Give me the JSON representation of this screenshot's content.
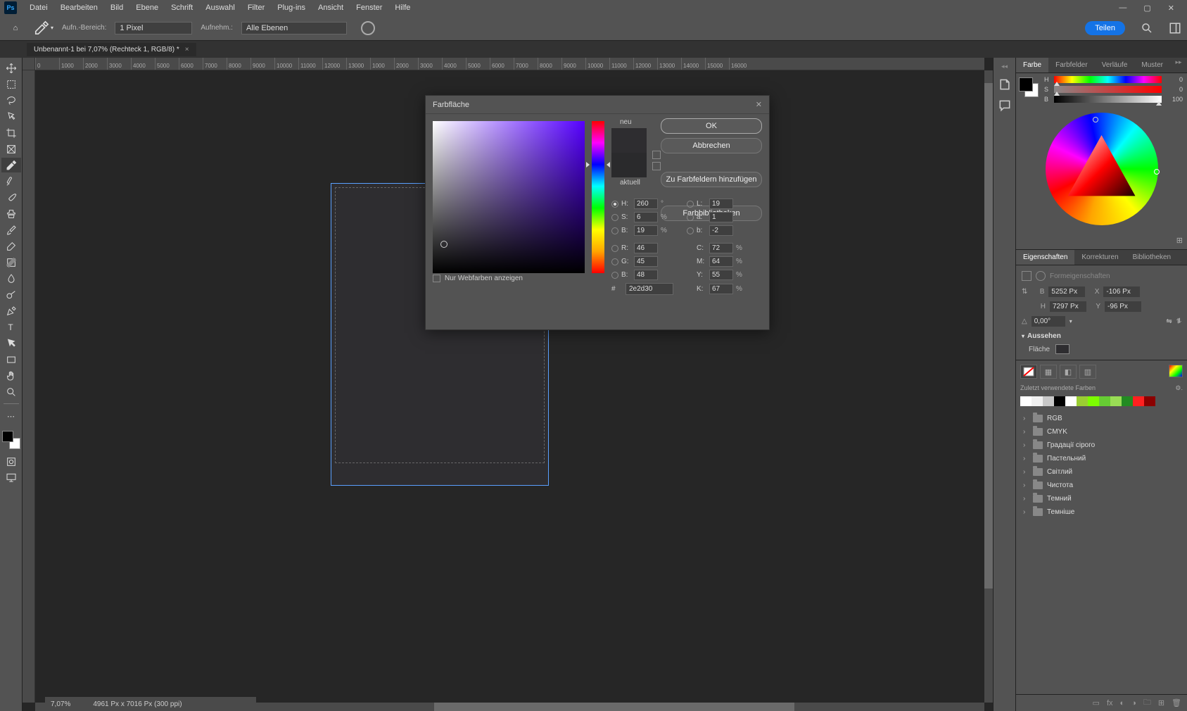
{
  "menubar": {
    "items": [
      "Datei",
      "Bearbeiten",
      "Bild",
      "Ebene",
      "Schrift",
      "Auswahl",
      "Filter",
      "Plug-ins",
      "Ansicht",
      "Fenster",
      "Hilfe"
    ]
  },
  "optionsbar": {
    "sample_label": "Aufn.-Bereich:",
    "sample_value": "1 Pixel",
    "sample2_label": "Aufnehm.:",
    "sample2_value": "Alle Ebenen",
    "share": "Teilen"
  },
  "doctab": {
    "title": "Unbenannt-1 bei 7,07% (Rechteck 1, RGB/8) *"
  },
  "ruler_marks": [
    "0",
    "1000",
    "2000",
    "3000",
    "4000",
    "5000",
    "6000",
    "7000",
    "8000",
    "9000",
    "10000",
    "11000",
    "12000",
    "13000",
    "1000",
    "2000",
    "3000",
    "4000",
    "5000",
    "6000",
    "7000",
    "8000",
    "9000",
    "10000",
    "11000",
    "12000",
    "13000",
    "14000",
    "15000",
    "16000"
  ],
  "footer": {
    "zoom": "7,07%",
    "docinfo": "4961 Px x 7016 Px (300 ppi)"
  },
  "color_panel": {
    "tabs": [
      "Farbe",
      "Farbfelder",
      "Verläufe",
      "Muster"
    ],
    "h": "0",
    "s": "0",
    "b": "100"
  },
  "props_panel": {
    "tabs": [
      "Eigenschaften",
      "Korrekturen",
      "Bibliotheken"
    ],
    "shape_label": "Formeigenschaften",
    "B": "5252 Px",
    "H": "7297 Px",
    "X": "-106 Px",
    "Y": "-96 Px",
    "angle": "0,00°",
    "section": "Aussehen",
    "fill_label": "Fläche"
  },
  "swatches_panel": {
    "recent_label": "Zuletzt verwendete Farben",
    "recent": [
      "#ffffff",
      "#f0f0f0",
      "#c8c8c8",
      "#000000",
      "#ffffff",
      "#9acd32",
      "#7cfc00",
      "#66cc33",
      "#99dd55",
      "#228b22",
      "#ff2020",
      "#8b0000"
    ],
    "folders": [
      "RGB",
      "CMYK",
      "Градації сірого",
      "Пастельний",
      "Світлий",
      "Чистота",
      "Темний",
      "Темніше"
    ]
  },
  "dialog": {
    "title": "Farbfläche",
    "new_label": "neu",
    "current_label": "aktuell",
    "ok": "OK",
    "cancel": "Abbrechen",
    "add_swatches": "Zu Farbfeldern hinzufügen",
    "libraries": "Farbbibliotheken",
    "webonly": "Nur Webfarben anzeigen",
    "H": "260",
    "S": "6",
    "Bv": "19",
    "L": "19",
    "a": "1",
    "b": "-2",
    "R": "46",
    "G": "45",
    "B2": "48",
    "C": "72",
    "M": "64",
    "Y": "55",
    "K": "67",
    "hex": "2e2d30"
  }
}
